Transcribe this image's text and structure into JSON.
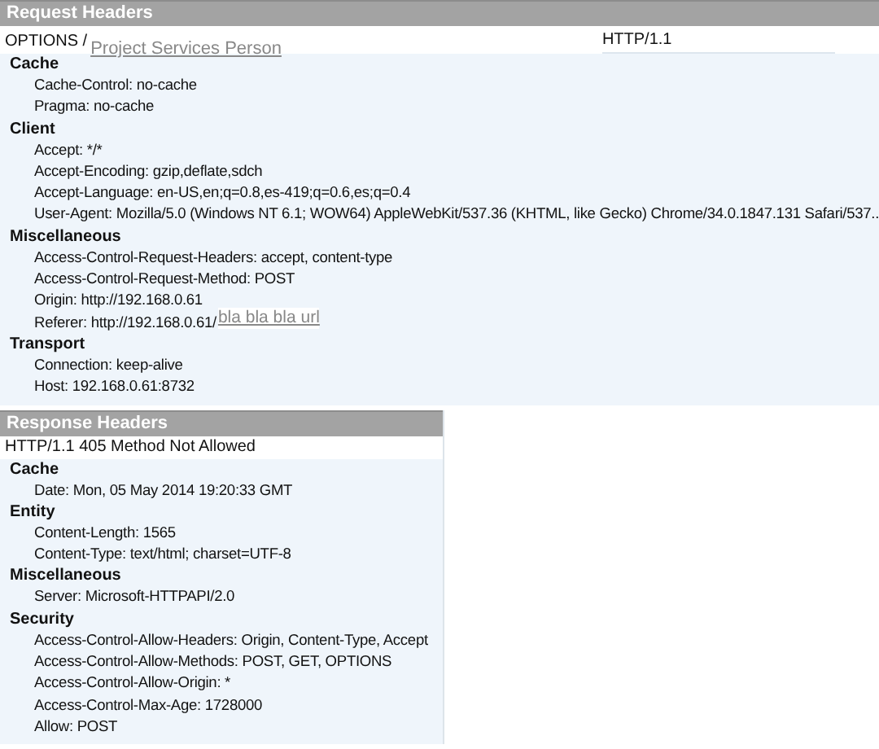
{
  "request": {
    "title": "Request Headers",
    "method": "OPTIONS /",
    "path_link": "Project Services Person",
    "protocol": "HTTP/1.1",
    "groups": [
      {
        "name": "Cache",
        "headers": [
          {
            "text": "Cache-Control: no-cache"
          },
          {
            "text": "Pragma: no-cache"
          }
        ]
      },
      {
        "name": "Client",
        "headers": [
          {
            "text": "Accept: */*"
          },
          {
            "text": "Accept-Encoding: gzip,deflate,sdch"
          },
          {
            "text": "Accept-Language: en-US,en;q=0.8,es-419;q=0.6,es;q=0.4"
          },
          {
            "text": "User-Agent: Mozilla/5.0 (Windows NT 6.1; WOW64) AppleWebKit/537.36 (KHTML, like Gecko) Chrome/34.0.1847.131 Safari/537.."
          }
        ]
      },
      {
        "name": "Miscellaneous",
        "headers": [
          {
            "text": "Access-Control-Request-Headers: accept, content-type"
          },
          {
            "text": "Access-Control-Request-Method: POST"
          },
          {
            "text": "Origin: http://192.168.0.61"
          },
          {
            "text": "Referer: http://192.168.0.61/",
            "link": "bla bla bla url"
          }
        ]
      },
      {
        "name": "Transport",
        "headers": [
          {
            "text": "Connection: keep-alive"
          },
          {
            "text": "Host: 192.168.0.61:8732"
          }
        ]
      }
    ]
  },
  "response": {
    "title": "Response Headers",
    "status_line": "HTTP/1.1 405 Method Not Allowed",
    "groups": [
      {
        "name": "Cache",
        "headers": [
          {
            "text": "Date: Mon, 05 May 2014 19:20:33 GMT"
          }
        ]
      },
      {
        "name": "Entity",
        "headers": [
          {
            "text": "Content-Length: 1565"
          },
          {
            "text": "Content-Type: text/html; charset=UTF-8"
          }
        ]
      },
      {
        "name": "Miscellaneous",
        "headers": [
          {
            "text": "Server: Microsoft-HTTPAPI/2.0"
          }
        ]
      },
      {
        "name": "Security",
        "headers": [
          {
            "text": "Access-Control-Allow-Headers: Origin, Content-Type, Accept"
          },
          {
            "text": "Access-Control-Allow-Methods: POST, GET, OPTIONS"
          },
          {
            "text": "Access-Control-Allow-Origin: *"
          },
          {
            "text": "Access-Control-Max-Age: 1728000"
          },
          {
            "text": "Allow: POST"
          }
        ]
      }
    ]
  }
}
